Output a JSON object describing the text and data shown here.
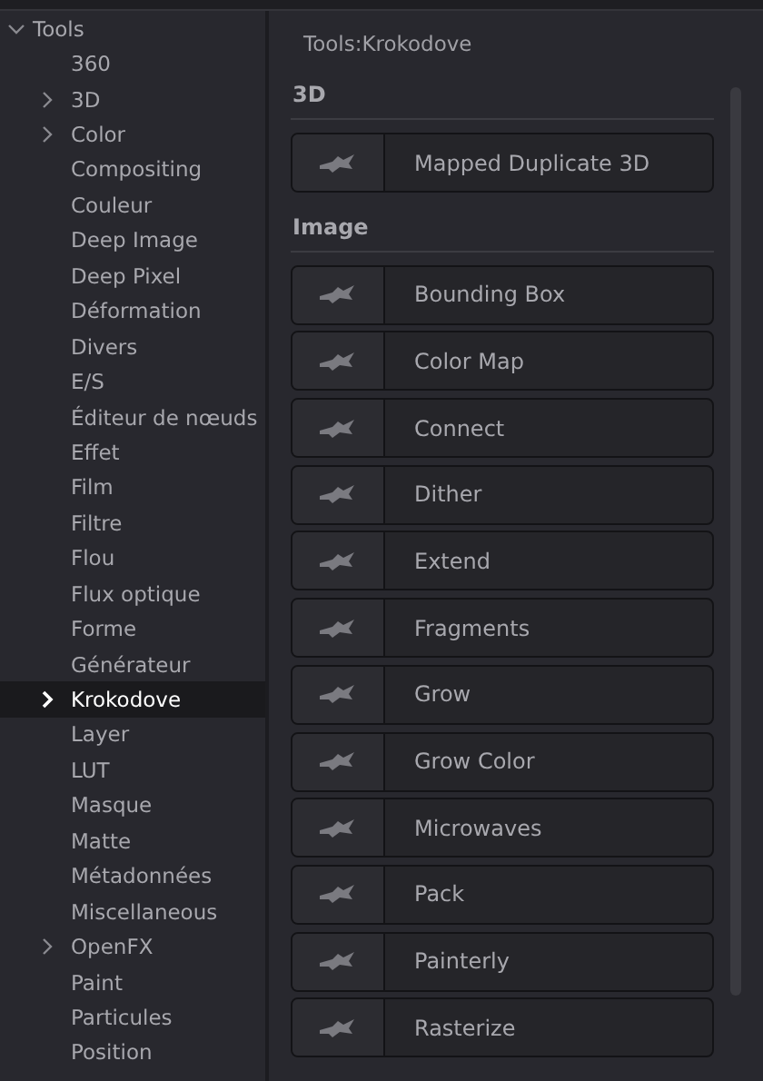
{
  "tree": {
    "label": "Tools",
    "expanded": true,
    "children": [
      {
        "label": "360",
        "expandable": false,
        "selected": false
      },
      {
        "label": "3D",
        "expandable": true,
        "selected": false
      },
      {
        "label": "Color",
        "expandable": true,
        "selected": false
      },
      {
        "label": "Compositing",
        "expandable": false,
        "selected": false
      },
      {
        "label": "Couleur",
        "expandable": false,
        "selected": false
      },
      {
        "label": "Deep Image",
        "expandable": false,
        "selected": false
      },
      {
        "label": "Deep Pixel",
        "expandable": false,
        "selected": false
      },
      {
        "label": "Déformation",
        "expandable": false,
        "selected": false
      },
      {
        "label": "Divers",
        "expandable": false,
        "selected": false
      },
      {
        "label": "E/S",
        "expandable": false,
        "selected": false
      },
      {
        "label": "Éditeur de nœuds",
        "expandable": false,
        "selected": false
      },
      {
        "label": "Effet",
        "expandable": false,
        "selected": false
      },
      {
        "label": "Film",
        "expandable": false,
        "selected": false
      },
      {
        "label": "Filtre",
        "expandable": false,
        "selected": false
      },
      {
        "label": "Flou",
        "expandable": false,
        "selected": false
      },
      {
        "label": "Flux optique",
        "expandable": false,
        "selected": false
      },
      {
        "label": "Forme",
        "expandable": false,
        "selected": false
      },
      {
        "label": "Générateur",
        "expandable": false,
        "selected": false
      },
      {
        "label": "Krokodove",
        "expandable": true,
        "selected": true
      },
      {
        "label": "Layer",
        "expandable": false,
        "selected": false
      },
      {
        "label": "LUT",
        "expandable": false,
        "selected": false
      },
      {
        "label": "Masque",
        "expandable": false,
        "selected": false
      },
      {
        "label": "Matte",
        "expandable": false,
        "selected": false
      },
      {
        "label": "Métadonnées",
        "expandable": false,
        "selected": false
      },
      {
        "label": "Miscellaneous",
        "expandable": false,
        "selected": false
      },
      {
        "label": "OpenFX",
        "expandable": true,
        "selected": false
      },
      {
        "label": "Paint",
        "expandable": false,
        "selected": false
      },
      {
        "label": "Particules",
        "expandable": false,
        "selected": false
      },
      {
        "label": "Position",
        "expandable": false,
        "selected": false
      }
    ]
  },
  "panel": {
    "path": "Tools:Krokodove",
    "sections": [
      {
        "title": "3D",
        "tools": [
          "Mapped Duplicate 3D"
        ]
      },
      {
        "title": "Image",
        "tools": [
          "Bounding Box",
          "Color Map",
          "Connect",
          "Dither",
          "Extend",
          "Fragments",
          "Grow",
          "Grow Color",
          "Microwaves",
          "Pack",
          "Painterly",
          "Rasterize"
        ]
      }
    ]
  }
}
